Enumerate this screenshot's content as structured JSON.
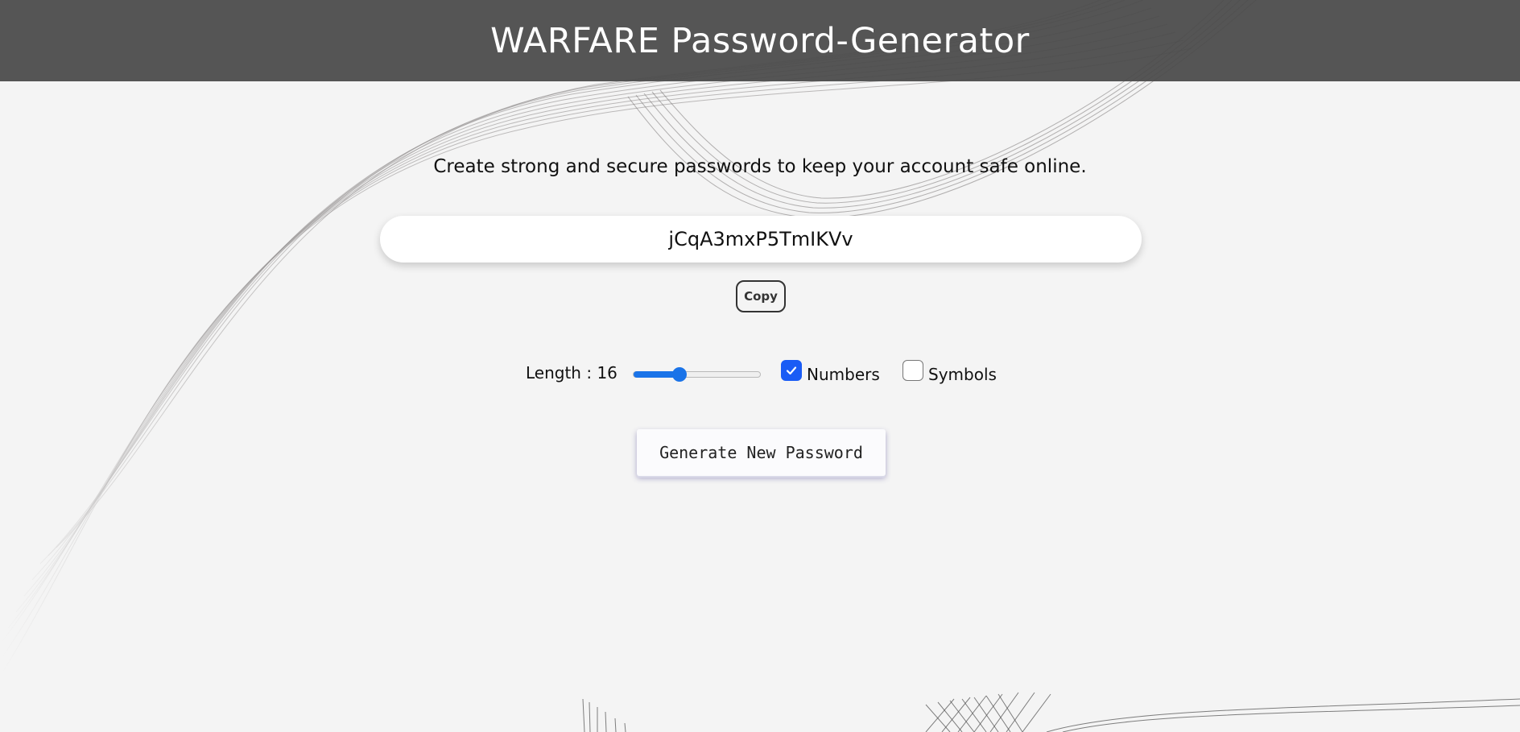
{
  "header": {
    "title": "WARFARE Password-Generator"
  },
  "main": {
    "tagline": "Create strong and secure passwords to keep your account safe online.",
    "password": "jCqA3mxP5TmIKVv",
    "copy_label": "Copy",
    "length_label": "Length : 16",
    "length_value": 16,
    "length_slider_fraction": 0.36,
    "options": {
      "numbers": {
        "label": "Numbers",
        "checked": true
      },
      "symbols": {
        "label": "Symbols",
        "checked": false
      }
    },
    "generate_label": "Generate New Password"
  },
  "colors": {
    "header_bg": "#4a4a4a",
    "page_bg": "#f4f4f4",
    "accent": "#1a5cf5",
    "slider_accent": "#1a73e8"
  }
}
